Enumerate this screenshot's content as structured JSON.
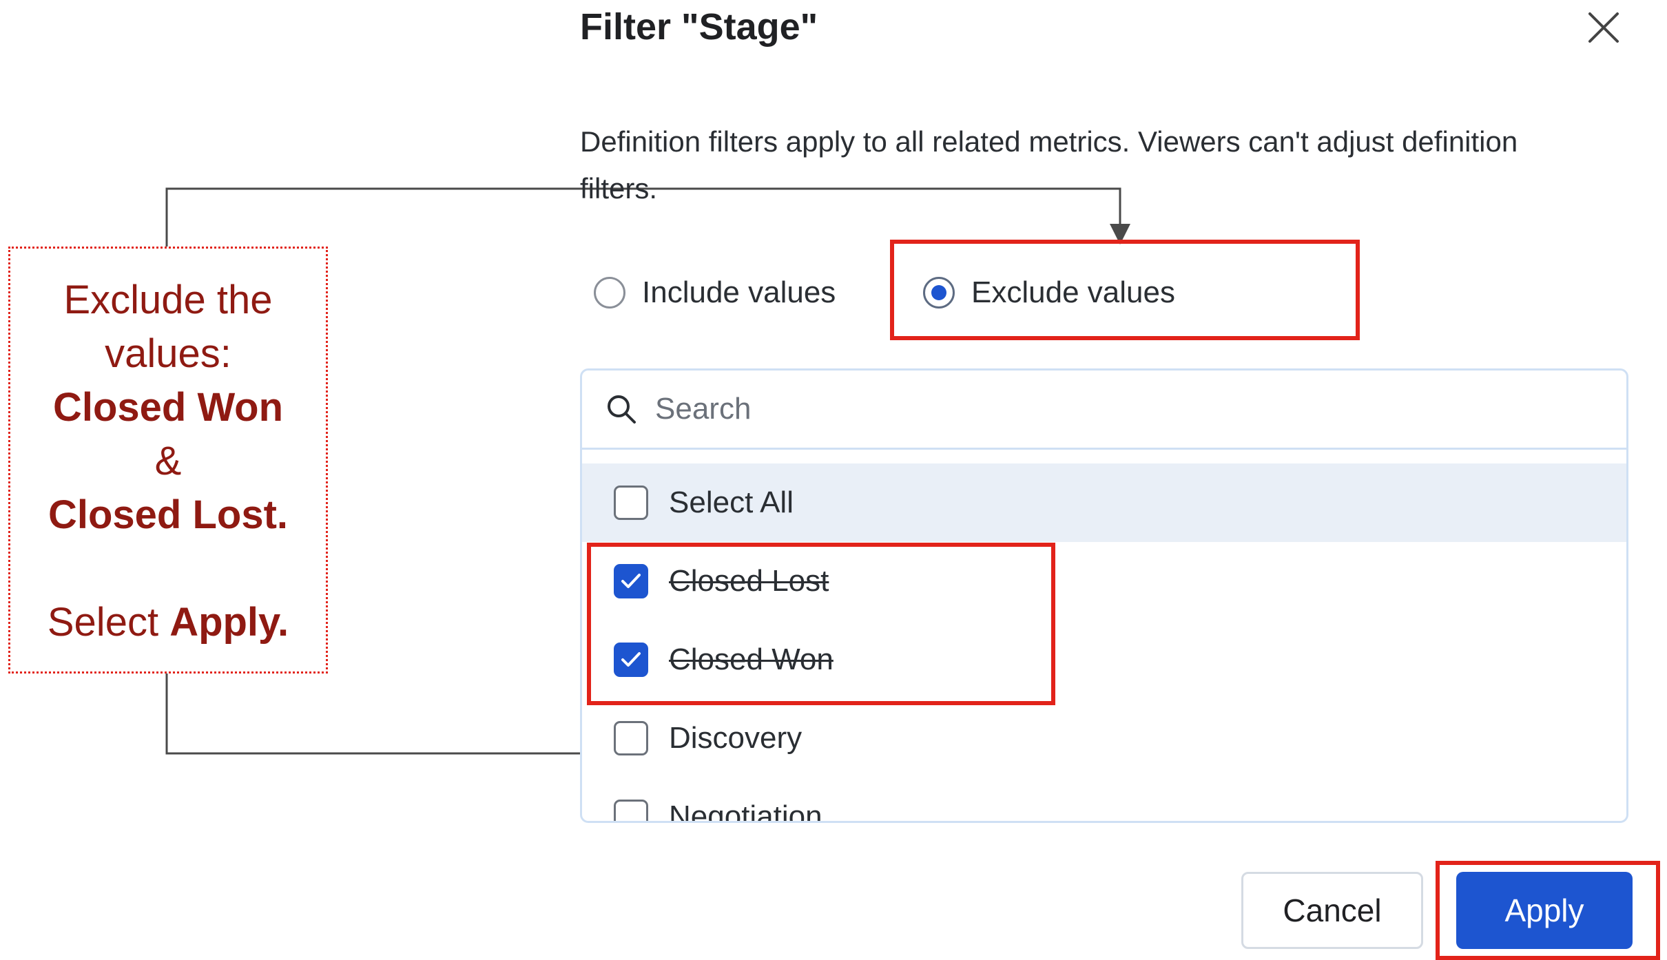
{
  "dialog": {
    "title": "Filter \"Stage\"",
    "description": "Definition filters apply to all related metrics. Viewers can't adjust definition filters."
  },
  "mode": {
    "include_label": "Include values",
    "exclude_label": "Exclude values",
    "selected": "exclude"
  },
  "search": {
    "placeholder": "Search",
    "value": ""
  },
  "list": {
    "select_all_label": "Select All",
    "items": [
      {
        "label": "Closed Lost",
        "checked": true
      },
      {
        "label": "Closed Won",
        "checked": true
      },
      {
        "label": "Discovery",
        "checked": false
      },
      {
        "label": "Negotiation",
        "checked": false
      }
    ]
  },
  "buttons": {
    "cancel_label": "Cancel",
    "apply_label": "Apply"
  },
  "annotation": {
    "line1": "Exclude the",
    "line2": "values:",
    "line3": "Closed Won",
    "line4": "&",
    "line5": "Closed Lost.",
    "line6_prefix": "Select ",
    "line6_bold": "Apply."
  },
  "colors": {
    "accent": "#1d55d0",
    "highlight_box": "#e2231a",
    "callout_text": "#8f1a12"
  }
}
